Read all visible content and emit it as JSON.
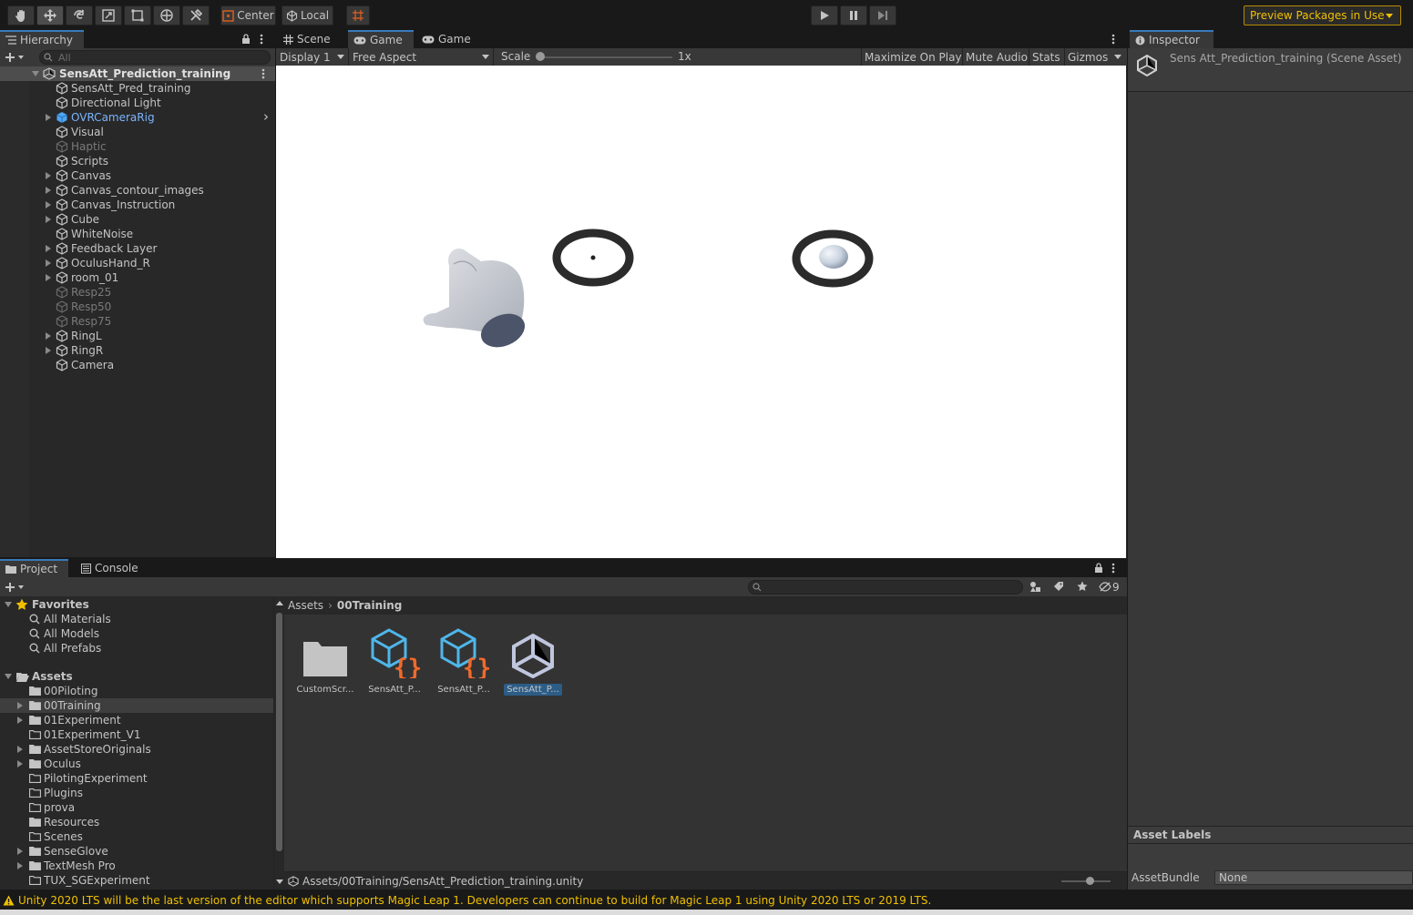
{
  "toolbar": {
    "pivot_mode": "Center",
    "pivot_rotation": "Local",
    "preview_packages": "Preview Packages in Use"
  },
  "hierarchy": {
    "tab": "Hierarchy",
    "search_placeholder": "All",
    "scene_name": "SensAtt_Prediction_training",
    "items": [
      {
        "label": "SensAtt_Pred_training",
        "state": "normal",
        "expandable": false
      },
      {
        "label": "Directional Light",
        "state": "normal",
        "expandable": false
      },
      {
        "label": "OVRCameraRig",
        "state": "prefab",
        "expandable": true
      },
      {
        "label": "Visual",
        "state": "normal",
        "expandable": false
      },
      {
        "label": "Haptic",
        "state": "disabled",
        "expandable": false
      },
      {
        "label": "Scripts",
        "state": "normal",
        "expandable": false
      },
      {
        "label": "Canvas",
        "state": "normal",
        "expandable": true
      },
      {
        "label": "Canvas_contour_images",
        "state": "normal",
        "expandable": true
      },
      {
        "label": "Canvas_Instruction",
        "state": "normal",
        "expandable": true
      },
      {
        "label": "Cube",
        "state": "normal",
        "expandable": true
      },
      {
        "label": "WhiteNoise",
        "state": "normal",
        "expandable": false
      },
      {
        "label": "Feedback Layer",
        "state": "normal",
        "expandable": true
      },
      {
        "label": "OculusHand_R",
        "state": "normal",
        "expandable": true
      },
      {
        "label": "room_01",
        "state": "normal",
        "expandable": true
      },
      {
        "label": "Resp25",
        "state": "disabled",
        "expandable": false
      },
      {
        "label": "Resp50",
        "state": "disabled",
        "expandable": false
      },
      {
        "label": "Resp75",
        "state": "disabled",
        "expandable": false
      },
      {
        "label": "RingL",
        "state": "normal",
        "expandable": true
      },
      {
        "label": "RingR",
        "state": "normal",
        "expandable": true
      },
      {
        "label": "Camera",
        "state": "normal",
        "expandable": false
      }
    ]
  },
  "viewport": {
    "tabs": [
      "Scene",
      "Game",
      "Game"
    ],
    "display": "Display 1",
    "aspect": "Free Aspect",
    "scale_label": "Scale",
    "scale_value": "1x",
    "scale_level": 0,
    "maximize": "Maximize On Play",
    "mute": "Mute Audio",
    "stats": "Stats",
    "gizmos": "Gizmos"
  },
  "inspector": {
    "tab": "Inspector",
    "title": "Sens Att_Prediction_training (Scene Asset)",
    "asset_labels": "Asset Labels",
    "assetbundle_label": "AssetBundle",
    "assetbundle_value": "None"
  },
  "project": {
    "tabs": [
      "Project",
      "Console"
    ],
    "hidden_count": "9",
    "favorites_label": "Favorites",
    "favorites": [
      "All Materials",
      "All Models",
      "All Prefabs"
    ],
    "assets_label": "Assets",
    "folders": [
      {
        "label": "00Piloting",
        "expandable": false,
        "filled": true
      },
      {
        "label": "00Training",
        "expandable": true,
        "filled": true
      },
      {
        "label": "01Experiment",
        "expandable": true,
        "filled": true
      },
      {
        "label": "01Experiment_V1",
        "expandable": false,
        "filled": false
      },
      {
        "label": "AssetStoreOriginals",
        "expandable": true,
        "filled": true
      },
      {
        "label": "Oculus",
        "expandable": true,
        "filled": true
      },
      {
        "label": "PilotingExperiment",
        "expandable": false,
        "filled": false
      },
      {
        "label": "Plugins",
        "expandable": false,
        "filled": false
      },
      {
        "label": "prova",
        "expandable": false,
        "filled": false
      },
      {
        "label": "Resources",
        "expandable": false,
        "filled": true
      },
      {
        "label": "Scenes",
        "expandable": false,
        "filled": false
      },
      {
        "label": "SenseGlove",
        "expandable": true,
        "filled": true
      },
      {
        "label": "TextMesh Pro",
        "expandable": true,
        "filled": true
      },
      {
        "label": "TUX_SGExperiment",
        "expandable": false,
        "filled": false
      }
    ],
    "breadcrumb": [
      "Assets",
      "00Training"
    ],
    "assets": [
      {
        "label": "CustomScr...",
        "icon": "folder-icon"
      },
      {
        "label": "SensAtt_P...",
        "icon": "script-asset-icon"
      },
      {
        "label": "SensAtt_P...",
        "icon": "script-asset-icon"
      },
      {
        "label": "SensAtt_P...",
        "icon": "unity-scene-icon",
        "selected": true
      }
    ],
    "path": "Assets/00Training/SensAtt_Prediction_training.unity"
  },
  "status": {
    "message": "Unity 2020 LTS will be the last version of the editor which supports Magic Leap 1. Developers can continue to build for Magic Leap 1 using Unity 2020 LTS or 2019 LTS."
  },
  "colors": {
    "accent": "#3a79bb",
    "selection": "#2c5d87",
    "warning": "#f0c000",
    "prefab": "#7ab4ff"
  }
}
